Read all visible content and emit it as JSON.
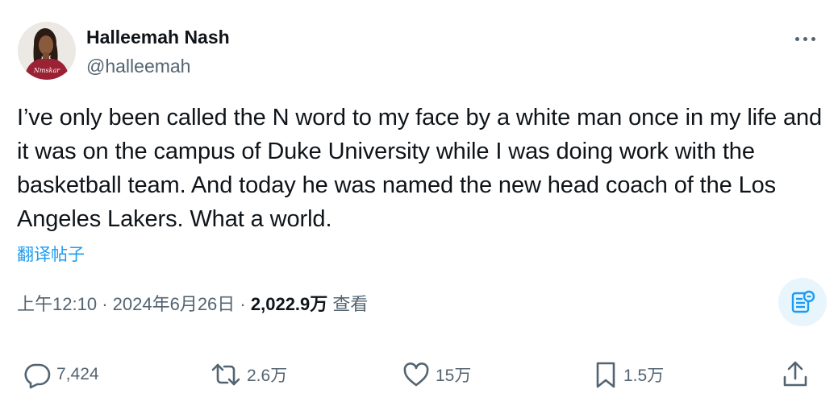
{
  "author": {
    "name": "Halleemah Nash",
    "handle": "@halleemah"
  },
  "tweet": {
    "text": "I’ve only been called the N word to my face by a white man once in my life and it was on the campus of Duke University while I was doing work with the basketball team. And today he was named the new head coach of the Los Angeles Lakers. What a world.",
    "translate_label": "翻译帖子"
  },
  "meta": {
    "time": "上午12:10",
    "separator": "·",
    "date": "2024年6月26日",
    "views_count": "2,022.9万",
    "views_label": "查看"
  },
  "actions": {
    "replies": "7,424",
    "reposts": "2.6万",
    "likes": "15万",
    "bookmarks": "1.5万"
  },
  "icons": {
    "more": "more-horizontal-icon",
    "grok": "grok-analyze-icon",
    "reply": "reply-icon",
    "repost": "repost-icon",
    "like": "heart-icon",
    "bookmark": "bookmark-icon",
    "share": "share-icon"
  },
  "colors": {
    "link": "#1d9bf0",
    "muted": "#536471",
    "text": "#0f1419",
    "avatar_sweater": "#9b2235"
  }
}
